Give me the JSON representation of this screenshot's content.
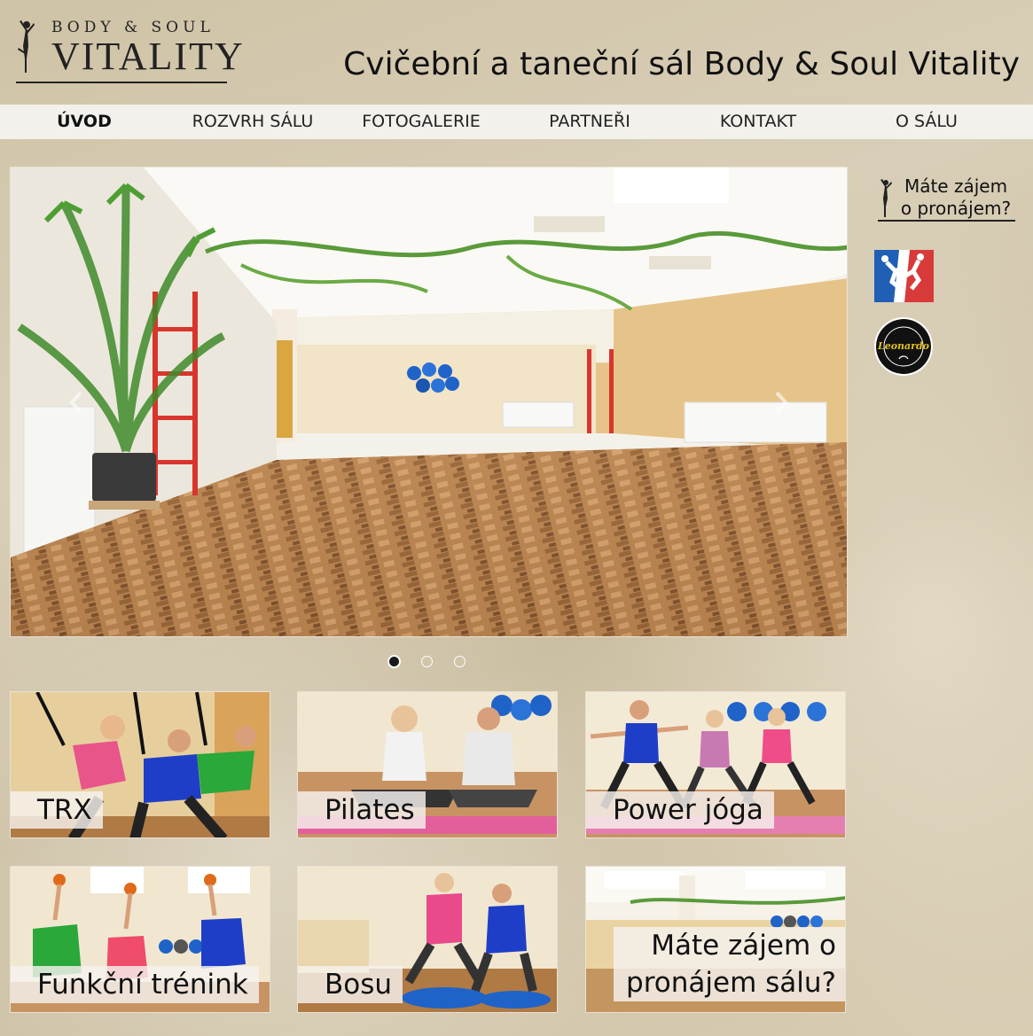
{
  "header": {
    "logo_top": "Body & Soul",
    "logo_main": "Vitality",
    "site_title": "Cvičební a taneční sál Body & Soul Vitality"
  },
  "nav": {
    "items": [
      {
        "label": "ÚVOD",
        "active": true
      },
      {
        "label": "ROZVRH SÁLU",
        "active": false
      },
      {
        "label": "FOTOGALERIE",
        "active": false
      },
      {
        "label": "PARTNEŘI",
        "active": false
      },
      {
        "label": "KONTAKT",
        "active": false
      },
      {
        "label": "O SÁLU",
        "active": false
      }
    ]
  },
  "slider": {
    "icons": {
      "prev": "chevron-left-icon",
      "next": "chevron-right-icon"
    },
    "slide_count": 3,
    "active_slide": 1
  },
  "sidebar": {
    "rent_line1": "Máte zájem",
    "rent_line2": "o pronájem?"
  },
  "partner2_badge": "Leonardo",
  "tiles": [
    {
      "label": "TRX"
    },
    {
      "label": "Pilates"
    },
    {
      "label": "Power jóga"
    },
    {
      "label": "Funkční trénink"
    },
    {
      "label": "Bosu"
    },
    {
      "label_line1": "Máte zájem o",
      "label_line2": "pronájem sálu?"
    }
  ],
  "colors": {
    "nav_bg": "#f3f1ec",
    "background": "#d4c8ad",
    "floor": "#b07a45",
    "wall": "#e9c98a"
  }
}
